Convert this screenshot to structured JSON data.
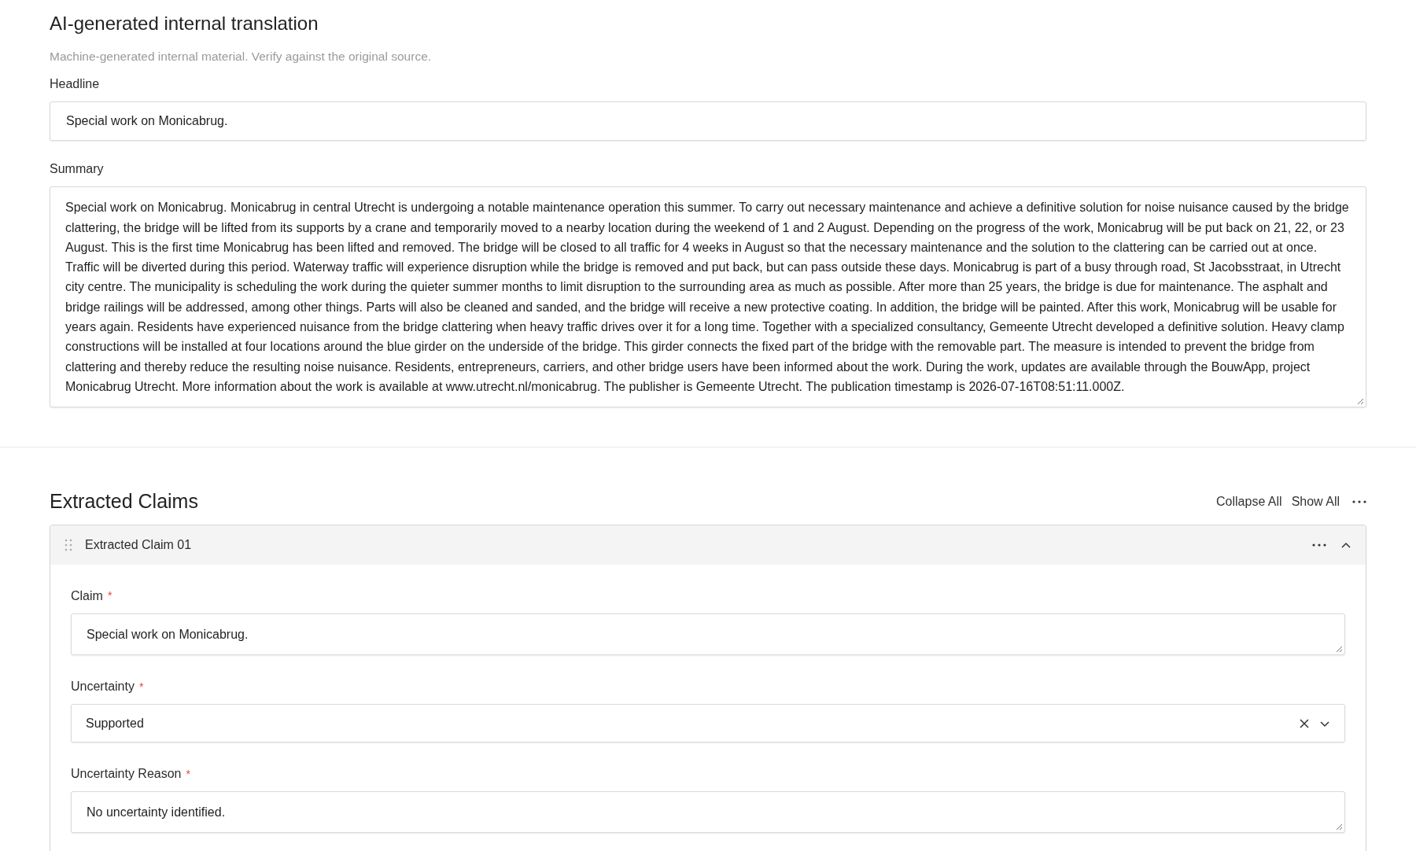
{
  "translation": {
    "title": "AI-generated internal translation",
    "note": "Machine-generated internal material. Verify against the original source.",
    "fields": [
      {
        "kind": "input",
        "label": "Headline",
        "value": "Special work on Monicabrug."
      },
      {
        "kind": "textarea",
        "label": "Summary",
        "value": "Special work on Monicabrug. Monicabrug in central Utrecht is undergoing a notable maintenance operation this summer. To carry out necessary maintenance and achieve a definitive solution for noise nuisance caused by the bridge clattering, the bridge will be lifted from its supports by a crane and temporarily moved to a nearby location during the weekend of 1 and 2 August. Depending on the progress of the work, Monicabrug will be put back on 21, 22, or 23 August. This is the first time Monicabrug has been lifted and removed. The bridge will be closed to all traffic for 4 weeks in August so that the necessary maintenance and the solution to the clattering can be carried out at once. Traffic will be diverted during this period. Waterway traffic will experience disruption while the bridge is removed and put back, but can pass outside these days. Monicabrug is part of a busy through road, St Jacobsstraat, in Utrecht city centre. The municipality is scheduling the work during the quieter summer months to limit disruption to the surrounding area as much as possible. After more than 25 years, the bridge is due for maintenance. The asphalt and bridge railings will be addressed, among other things. Parts will also be cleaned and sanded, and the bridge will receive a new protective coating. In addition, the bridge will be painted. After this work, Monicabrug will be usable for years again. Residents have experienced nuisance from the bridge clattering when heavy traffic drives over it for a long time. Together with a specialized consultancy, Gemeente Utrecht developed a definitive solution. Heavy clamp constructions will be installed at four locations around the blue girder on the underside of the bridge. This girder connects the fixed part of the bridge with the removable part. The measure is intended to prevent the bridge from clattering and thereby reduce the resulting noise nuisance. Residents, entrepreneurs, carriers, and other bridge users have been informed about the work. During the work, updates are available through the BouwApp, project Monicabrug Utrecht. More information about the work is available at www.utrecht.nl/monicabrug. The publisher is Gemeente Utrecht. The publication timestamp is 2026-07-16T08:51:11.000Z."
      }
    ]
  },
  "claims": {
    "title": "Extracted Claims",
    "actions": [
      "Collapse All",
      "Show All"
    ],
    "items": [
      {
        "title": "Extracted Claim 01",
        "expanded": true,
        "fields": [
          {
            "kind": "textarea",
            "label": "Claim",
            "required_mark": "*",
            "value": "Special work on Monicabrug."
          },
          {
            "kind": "select",
            "label": "Uncertainty",
            "required_mark": "*",
            "value": "Supported"
          },
          {
            "kind": "textarea",
            "label": "Uncertainty Reason",
            "required_mark": "*",
            "value": "No uncertainty identified."
          }
        ]
      }
    ]
  }
}
